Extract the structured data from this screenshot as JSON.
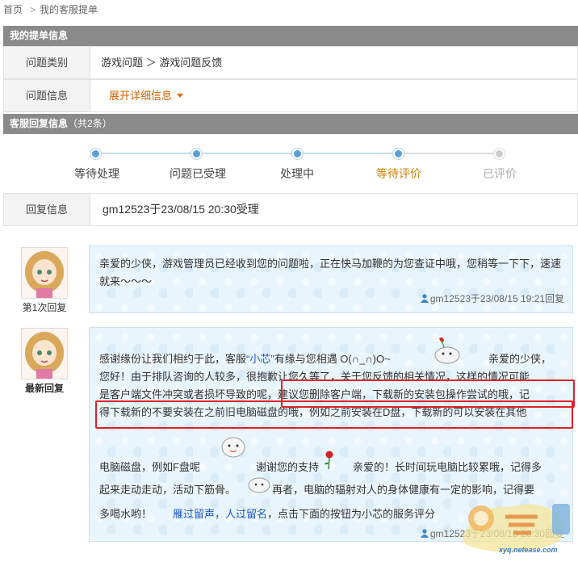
{
  "breadcrumb": {
    "home": "首页",
    "current": "我的客服提单"
  },
  "ticket_section": {
    "title": "我的提单信息"
  },
  "category": {
    "label": "问题类别",
    "value": "游戏问题 ＞ 游戏问题反馈"
  },
  "info": {
    "label": "问题信息",
    "expand": "展开详细信息"
  },
  "reply_section": {
    "title": "客服回复信息",
    "count": "（共2条）"
  },
  "progress": {
    "steps": [
      "等待处理",
      "问题已受理",
      "处理中",
      "等待评价",
      "已评价"
    ],
    "active_step": "等待评价",
    "colors": {
      "done": "#5aa0d8",
      "active": "#d08000",
      "pending": "#aaaaaa"
    }
  },
  "reply_info": {
    "label": "回复信息",
    "value": "gm12523于23/08/15 20:30受理"
  },
  "messages": [
    {
      "tag": "第1次回复",
      "text": "亲爱的少侠，游戏管理员已经收到您的问题啦，正在快马加鞭的为您查证中哦，您稍等一下下，速速就来～～～",
      "meta": "gm12523于23/08/15 19:21回复"
    },
    {
      "tag": "最新回复",
      "line1a": "感谢缘份让我们相约于此，客服",
      "name": "“小芯”",
      "line1b": "有缘与您相遇 O(∩_∩)O~",
      "line1c": "亲爱的少侠，",
      "line2": "您好！由于排队咨询的人较多，很抱歉让您久等了，关于您反馈的相关情况，这样的情况可能",
      "line3": "是客户端文件冲突或者损坏导致的呢，建议您删除客户端，下载新的安装包操作尝试的哦，记",
      "line4": "得下载新的不要安装在之前旧电脑磁盘的哦，例如之前安装在D盘，下载新的可以安装在其他",
      "line5a": "电脑磁盘，例如F盘呢",
      "line5b": "谢谢您的支持",
      "line5c": "亲爱的！长时间玩电脑比较累哦，记得多",
      "line6a": "起来走动走动，活动下筋骨。",
      "line6b": "再者，电脑的辐射对人的身体健康有一定的影响，记得要",
      "line7a": "多喝水哟！",
      "line7link": "雁过留声，人过留名",
      "line7b": "，点击下面的按钮为小芯的服务评分",
      "meta": "gm12523于23/08/15 20:30回复"
    }
  ],
  "watermark": {
    "text": "xyq.netease.com"
  },
  "highlight_color": "#e0202a"
}
